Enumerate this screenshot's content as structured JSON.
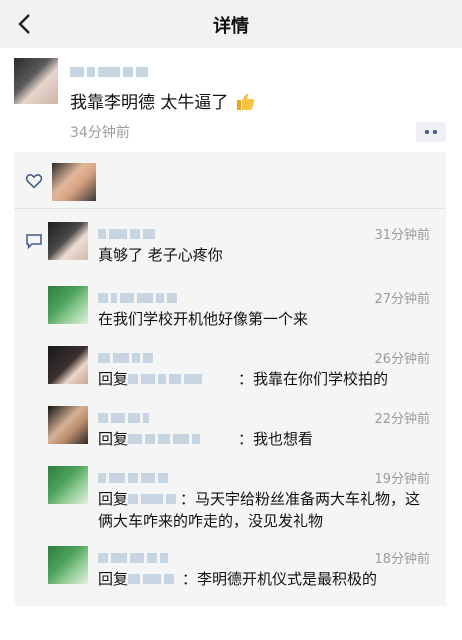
{
  "header": {
    "title": "详情"
  },
  "post": {
    "text": "我靠李明德 太牛逼了",
    "time": "34分钟前"
  },
  "comments": [
    {
      "time": "31分钟前",
      "text": "真够了 老子心疼你"
    },
    {
      "time": "27分钟前",
      "text": "在我们学校开机他好像第一个来"
    },
    {
      "time": "26分钟前",
      "prefix": "回复",
      "text": "：我靠在你们学校拍的"
    },
    {
      "time": "22分钟前",
      "prefix": "回复",
      "text": "：我也想看"
    },
    {
      "time": "19分钟前",
      "prefix": "回复",
      "text": "：马天宇给粉丝准备两大车礼物，这俩大车咋来的咋走的，没见发礼物"
    },
    {
      "time": "18分钟前",
      "prefix": "回复",
      "text": "：李明德开机仪式是最积极的"
    }
  ],
  "icons": {
    "back": "chevron-left-icon",
    "thumbs": "thumbs-up-icon",
    "more": "more-dots-icon",
    "heart": "heart-icon",
    "comment": "comment-icon"
  },
  "colors": {
    "header_bg": "#f2f2f2",
    "panel_bg": "#f5f5f5",
    "time_text": "#9b9b9b",
    "link_blue": "#3e5a8a"
  }
}
